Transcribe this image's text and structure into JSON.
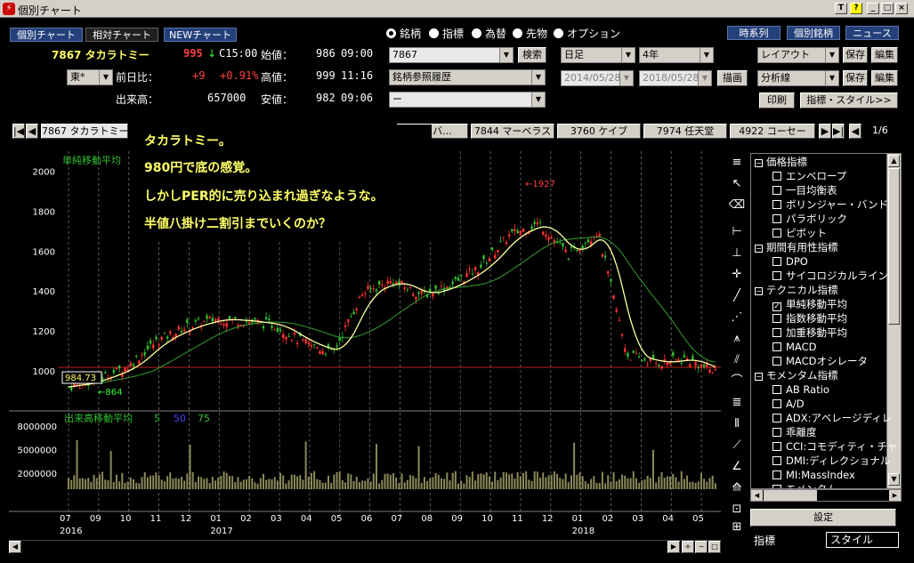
{
  "window": {
    "title": "個別チャート"
  },
  "nav_buttons": [
    "個別チャート",
    "相対チャート",
    "NEWチャート"
  ],
  "right_buttons": [
    "時系列",
    "個別銘柄",
    "ニュース"
  ],
  "asset_radios": [
    {
      "label": "銘柄",
      "selected": true
    },
    {
      "label": "指標",
      "selected": false
    },
    {
      "label": "為替",
      "selected": false
    },
    {
      "label": "先物",
      "selected": false
    },
    {
      "label": "オプション",
      "selected": false
    }
  ],
  "quote": {
    "code_name": "7867 タカラトミー",
    "price": "995",
    "arrow": "↓",
    "time": "C15:00",
    "exchange": "東*",
    "prev_label": "前日比：",
    "change": "+9",
    "change_pct": "+0.91%",
    "volume_label": "出来高：",
    "volume": "657000",
    "open_label": "始値：",
    "open": "986",
    "open_time": "09:00",
    "high_label": "高値：",
    "high": "999",
    "high_time": "11:16",
    "low_label": "安値：",
    "low": "982",
    "low_time": "09:06"
  },
  "search": {
    "code_value": "7867",
    "search_button": "検索",
    "history_value": "銘柄参照履歴",
    "third_value": "ー"
  },
  "period": {
    "interval": "日足",
    "range": "4年",
    "date_from": "2014/05/28",
    "date_to": "2018/05/28",
    "draw_button": "描画"
  },
  "controls": {
    "layout_label": "レイアウト",
    "save1": "保存",
    "edit1": "編集",
    "analysis_label": "分析線",
    "save2": "保存",
    "edit2": "編集",
    "print": "印刷",
    "indicator_style": "指標・スタイル>>"
  },
  "tabs": [
    {
      "label": "7867 タカラトミー",
      "active": true
    },
    {
      "label": "バイバ...",
      "active": false
    },
    {
      "label": "7844 マーベラス",
      "active": false
    },
    {
      "label": "3760 ケイブ",
      "active": false
    },
    {
      "label": "7974 任天堂",
      "active": false
    },
    {
      "label": "4922 コーセー",
      "active": false
    }
  ],
  "tab_page": "1/6",
  "overlay_note": [
    "タカラトミー。",
    "980円で底の感覚。",
    "しかしPER的に売り込まれ過ぎなような。",
    "半値八掛け二割引までいくのか？"
  ],
  "chart_labels": {
    "ma_title": "単純移動平均",
    "vol_title": "出来高移動平均",
    "vol_ma": [
      "5",
      "50",
      "75"
    ],
    "price_ticks": [
      "2000",
      "1800",
      "1600",
      "1400",
      "1200",
      "1000"
    ],
    "vol_ticks": [
      "8000000",
      "5000000",
      "2000000"
    ],
    "month_ticks": [
      "07",
      "09",
      "10",
      "11",
      "12",
      "01",
      "02",
      "03",
      "04",
      "05",
      "06",
      "07",
      "08",
      "09",
      "10",
      "11",
      "12",
      "01",
      "02",
      "03",
      "04",
      "05"
    ],
    "year_ticks": [
      "2016",
      "2017",
      "2018"
    ],
    "low_annot": "984.73",
    "low_marker": "←864",
    "high_marker": "←1927"
  },
  "chart_data": {
    "type": "line",
    "title": "",
    "x": [
      "2016-07",
      "2016-08",
      "2016-09",
      "2016-10",
      "2016-11",
      "2016-12",
      "2017-01",
      "2017-02",
      "2017-03",
      "2017-04",
      "2017-05",
      "2017-06",
      "2017-07",
      "2017-08",
      "2017-09",
      "2017-10",
      "2017-11",
      "2017-12",
      "2018-01",
      "2018-02",
      "2018-03",
      "2018-04",
      "2018-05"
    ],
    "series": [
      {
        "name": "",
        "values": [
          920,
          960,
          1020,
          1150,
          1220,
          1260,
          1250,
          1230,
          1140,
          1090,
          1390,
          1450,
          1380,
          1430,
          1520,
          1680,
          1740,
          1580,
          1700,
          1080,
          1040,
          1060,
          995
        ]
      }
    ],
    "ylim": [
      800,
      2100
    ],
    "color": "#ffffaa"
  },
  "panel": {
    "groups": [
      {
        "label": "価格指標",
        "items": [
          {
            "label": "エンベロープ",
            "checked": false
          },
          {
            "label": "一目均衡表",
            "checked": false
          },
          {
            "label": "ボリンジャー・バンド",
            "checked": false
          },
          {
            "label": "パラボリック",
            "checked": false
          },
          {
            "label": "ピボット",
            "checked": false
          }
        ]
      },
      {
        "label": "期間有用性指標",
        "items": [
          {
            "label": "DPO",
            "checked": false
          },
          {
            "label": "サイコロジカルライン",
            "checked": false
          }
        ]
      },
      {
        "label": "テクニカル指標",
        "items": [
          {
            "label": "単純移動平均",
            "checked": true
          },
          {
            "label": "指数移動平均",
            "checked": false
          },
          {
            "label": "加重移動平均",
            "checked": false
          },
          {
            "label": "MACD",
            "checked": false
          },
          {
            "label": "MACDオシレータ",
            "checked": false
          }
        ]
      },
      {
        "label": "モメンタム指標",
        "items": [
          {
            "label": "AB Ratio",
            "checked": false
          },
          {
            "label": "A/D",
            "checked": false
          },
          {
            "label": "ADX:アベレージディレ",
            "checked": false
          },
          {
            "label": "乖離度",
            "checked": false
          },
          {
            "label": "CCI:コモディティ・チャ",
            "checked": false
          },
          {
            "label": "DMI:ディレクショナル",
            "checked": false
          },
          {
            "label": "MI:MassIndex",
            "checked": false
          },
          {
            "label": "モメンタム",
            "checked": false
          }
        ]
      }
    ],
    "settings_button": "設定",
    "bottom_tabs": [
      "指標",
      "スタイル"
    ]
  },
  "colors": {
    "price_up": "#ff3030",
    "price_down": "#30c030",
    "ma": "#ffffa0",
    "ma_long": "#30a030",
    "accent": "#24407a"
  }
}
